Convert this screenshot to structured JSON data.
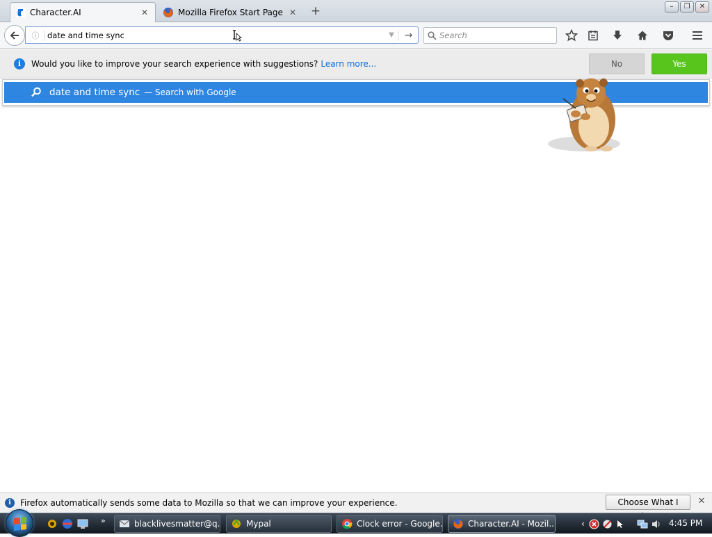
{
  "tabs": [
    {
      "label": "Character.AI",
      "active": true,
      "icon": "character-ai-icon"
    },
    {
      "label": "Mozilla Firefox Start Page",
      "active": false,
      "icon": "firefox-icon"
    }
  ],
  "navbar": {
    "url_value": "date and time sync",
    "search_placeholder": "Search"
  },
  "suggest_bar": {
    "message": "Would you like to improve your search experience with suggestions?",
    "learn_more": "Learn more...",
    "no_label": "No",
    "yes_label": "Yes"
  },
  "autocomplete": {
    "query": "date and time sync",
    "action": "— Search with Google"
  },
  "data_bar": {
    "message": "Firefox automatically sends some data to Mozilla so that we can improve your experience.",
    "button_label": "Choose What I Share"
  },
  "taskbar": {
    "tasks": [
      {
        "label": "blacklivesmatter@q...",
        "icon": "email-icon"
      },
      {
        "label": "Mypal",
        "icon": "mypal-icon"
      },
      {
        "label": "Clock error - Google...",
        "icon": "chrome-icon"
      },
      {
        "label": "Character.AI - Mozil...",
        "icon": "firefox-icon",
        "active": true
      }
    ],
    "clock": "4:45 PM"
  },
  "colors": {
    "autocomplete_highlight": "#2f86e0",
    "yes_button": "#58c51d",
    "info_blue": "#1d7ce0"
  }
}
